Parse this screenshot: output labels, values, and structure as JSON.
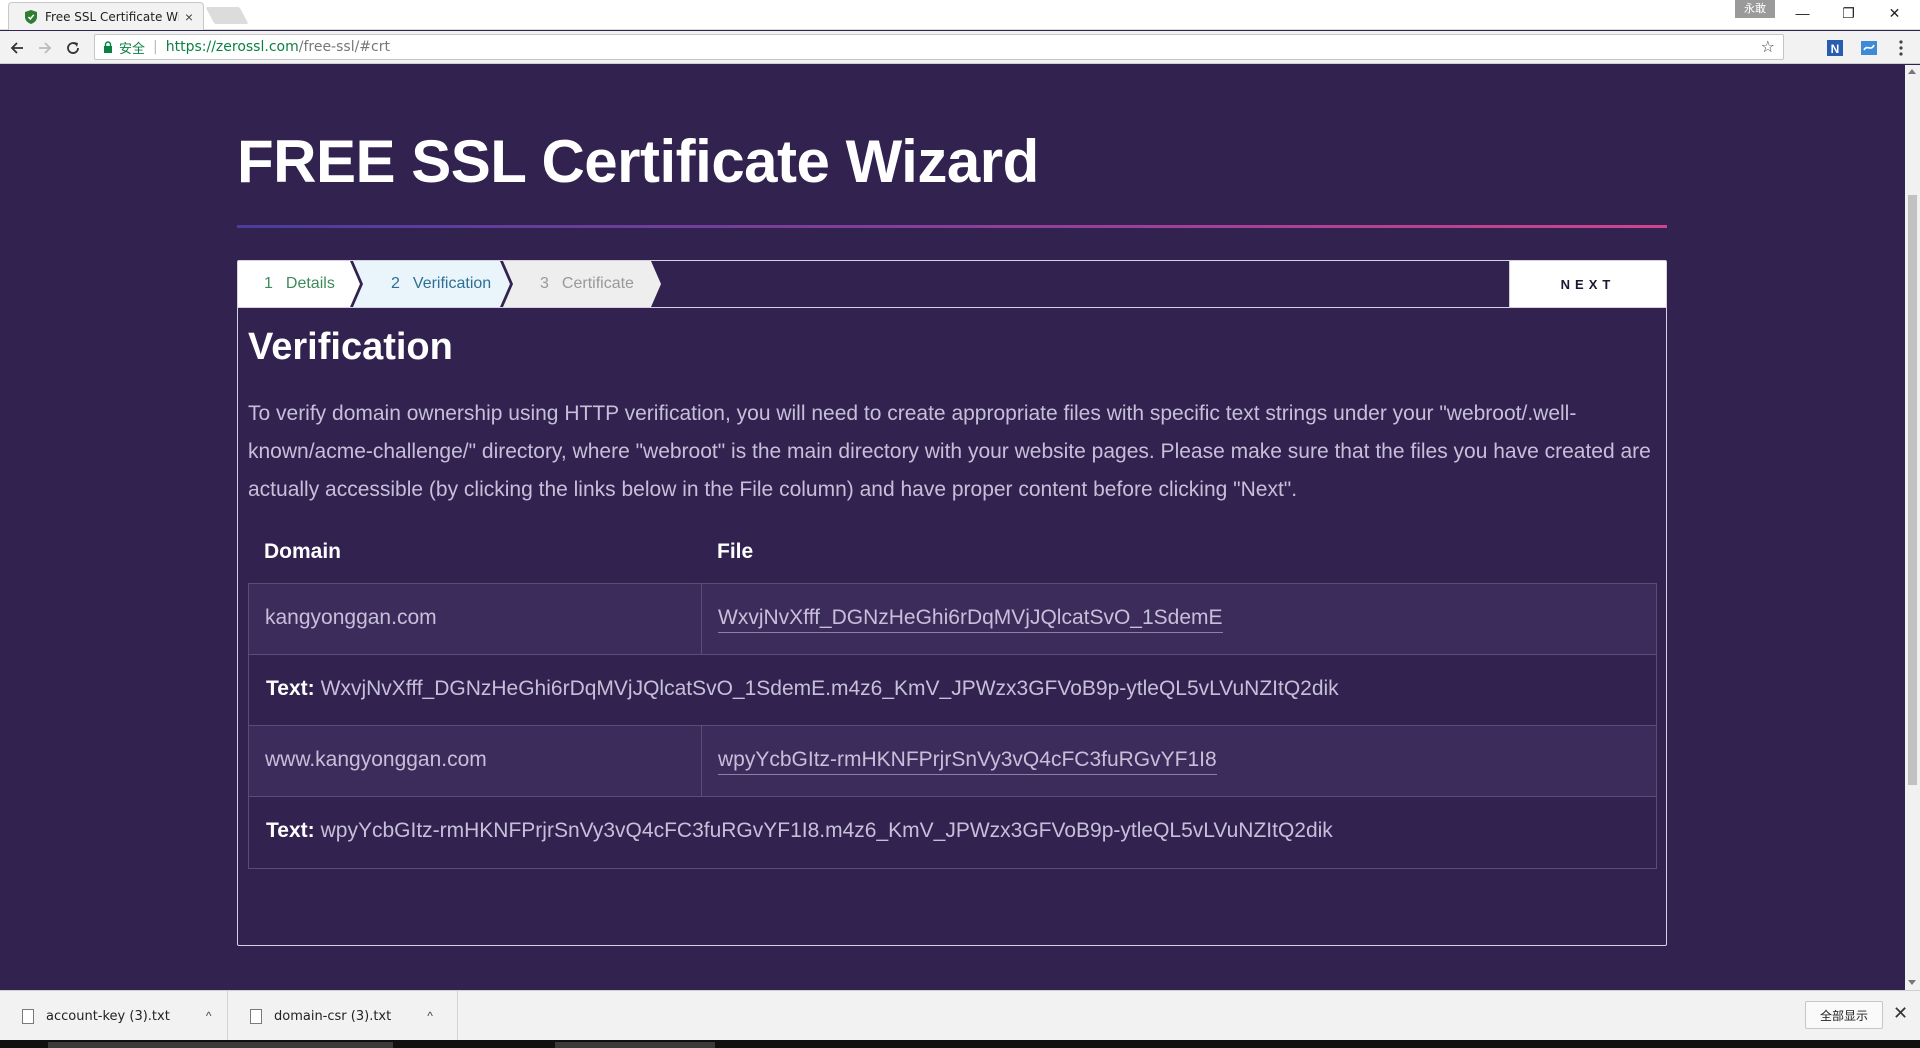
{
  "browser": {
    "tab_title": "Free SSL Certificate Wi",
    "tab_close": "×",
    "profile_badge": "永敢",
    "window_controls": {
      "minimize": "—",
      "restore": "❐",
      "close": "✕"
    },
    "address": {
      "secure_label": "安全",
      "separator": "|",
      "url_host": "https://zerossl.com",
      "url_path": "/free-ssl/#crt"
    }
  },
  "page": {
    "title": "FREE SSL Certificate Wizard",
    "steps": [
      {
        "num": "1",
        "label": "Details"
      },
      {
        "num": "2",
        "label": "Verification"
      },
      {
        "num": "3",
        "label": "Certificate"
      }
    ],
    "next_label": "NEXT",
    "section_title": "Verification",
    "intro": "To verify domain ownership using HTTP verification, you will need to create appropriate files with specific text strings under your \"webroot/.well-known/acme-challenge/\" directory, where \"webroot\" is the main directory with your website pages. Please make sure that the files you have created are actually accessible (by clicking the links below in the File column) and have proper content before clicking \"Next\".",
    "table": {
      "headers": {
        "domain": "Domain",
        "file": "File"
      },
      "text_label": "Text:",
      "rows": [
        {
          "domain": "kangyonggan.com",
          "file": "WxvjNvXfff_DGNzHeGhi6rDqMVjJQlcatSvO_1SdemE",
          "text": "WxvjNvXfff_DGNzHeGhi6rDqMVjJQlcatSvO_1SdemE.m4z6_KmV_JPWzx3GFVoB9p-ytleQL5vLVuNZItQ2dik"
        },
        {
          "domain": "www.kangyonggan.com",
          "file": "wpyYcbGItz-rmHKNFPrjrSnVy3vQ4cFC3fuRGvYF1I8",
          "text": "wpyYcbGItz-rmHKNFPrjrSnVy3vQ4cFC3fuRGvYF1I8.m4z6_KmV_JPWzx3GFVoB9p-ytleQL5vLVuNZItQ2dik"
        }
      ]
    }
  },
  "downloads": {
    "items": [
      {
        "name": "account-key (3).txt"
      },
      {
        "name": "domain-csr (3).txt"
      }
    ],
    "show_all": "全部显示",
    "close": "✕"
  },
  "colors": {
    "page_bg": "#32224f",
    "row_alt_bg": "#3c2c5c",
    "text_muted": "#c6bfd9",
    "accent_gradient_start": "#4b3d9c",
    "accent_gradient_end": "#d0448e",
    "secure_green": "#0b8043"
  }
}
